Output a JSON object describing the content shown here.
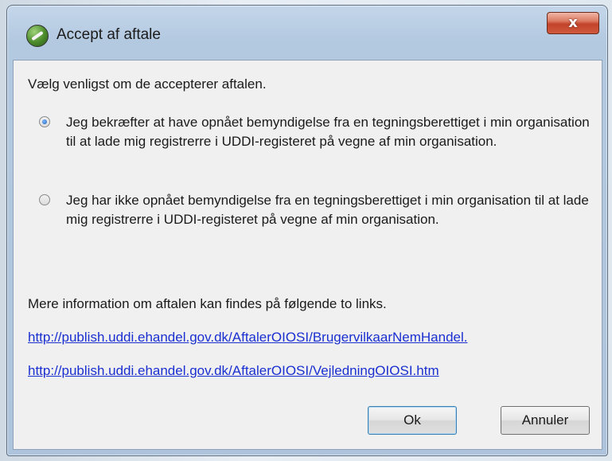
{
  "window": {
    "title": "Accept af aftale",
    "close_symbol": "x",
    "icon": "globe-app-icon"
  },
  "dialog": {
    "intro": "Vælg venligst om de accepterer aftalen.",
    "options": [
      {
        "label": "Jeg bekræfter at have opnået bemyndigelse fra en tegningsberettiget i min organisation til at lade mig registrerre i UDDI-registeret på vegne af min organisation.",
        "checked": true
      },
      {
        "label": "Jeg har ikke opnået bemyndigelse fra en tegningsberettiget i min organisation til at lade mig registrerre i UDDI-registeret på vegne af min organisation.",
        "checked": false
      }
    ],
    "info": "Mere information om aftalen kan findes på følgende to links.",
    "links": [
      "http://publish.uddi.ehandel.gov.dk/AftalerOIOSI/BrugervilkaarNemHandel.",
      "http://publish.uddi.ehandel.gov.dk/AftalerOIOSI/VejledningOIOSI.htm"
    ]
  },
  "buttons": {
    "ok": "Ok",
    "cancel": "Annuler"
  }
}
